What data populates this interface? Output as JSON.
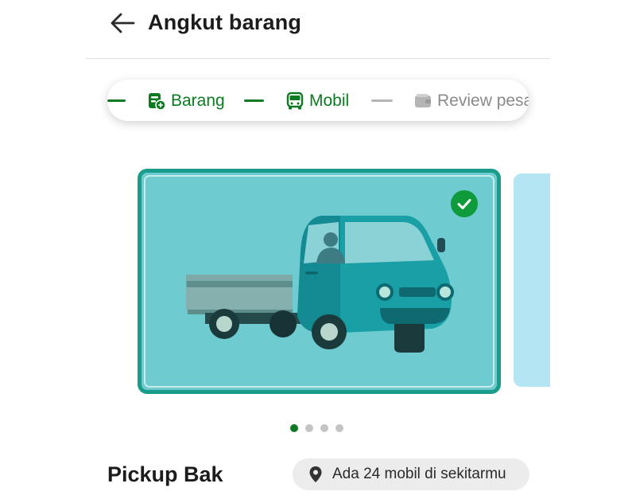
{
  "header": {
    "title": "Angkut barang"
  },
  "stepper": {
    "steps": [
      {
        "label": "Barang",
        "icon": "cargo-icon",
        "state": "active"
      },
      {
        "label": "Mobil",
        "icon": "car-icon",
        "state": "active"
      },
      {
        "label": "Review pesanan",
        "icon": "wallet-icon",
        "state": "inactive"
      }
    ]
  },
  "carousel": {
    "selected_index": 0,
    "page_count": 4,
    "items": [
      {
        "name": "Pickup Bak",
        "selected": true
      }
    ]
  },
  "vehicle": {
    "name": "Pickup Bak",
    "availability": "Ada 24 mobil di sekitarmu"
  },
  "colors": {
    "accent": "#0b7a21",
    "card_bg": "#6ecbcf",
    "card_border": "#1a9c8a",
    "check": "#0f9a3b"
  }
}
